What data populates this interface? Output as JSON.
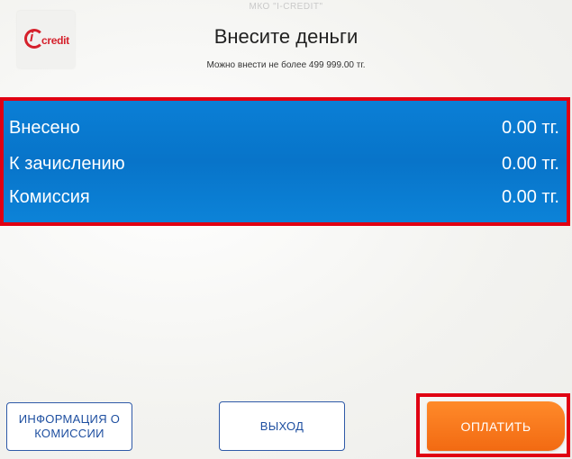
{
  "header": {
    "org_name": "МКО \"I-CREDIT\"",
    "logo_text": "credit",
    "logo_i": "i",
    "title": "Внесите деньги",
    "subtitle": "Можно внести не более 499 999.00 тг."
  },
  "summary": {
    "rows": [
      {
        "label": "Внесено",
        "value": "0.00 тг."
      },
      {
        "label": "К зачислению",
        "value": "0.00 тг."
      },
      {
        "label": "Комиссия",
        "value": "0.00 тг."
      }
    ]
  },
  "buttons": {
    "info_line1": "ИНФОРМАЦИЯ О",
    "info_line2": "КОМИССИИ",
    "exit": "ВЫХОД",
    "pay": "ОПЛАТИТЬ"
  },
  "colors": {
    "panel_blue": "#0874c9",
    "highlight_red": "#e00012",
    "pay_orange": "#f26a12",
    "brand_red": "#d5202b"
  }
}
